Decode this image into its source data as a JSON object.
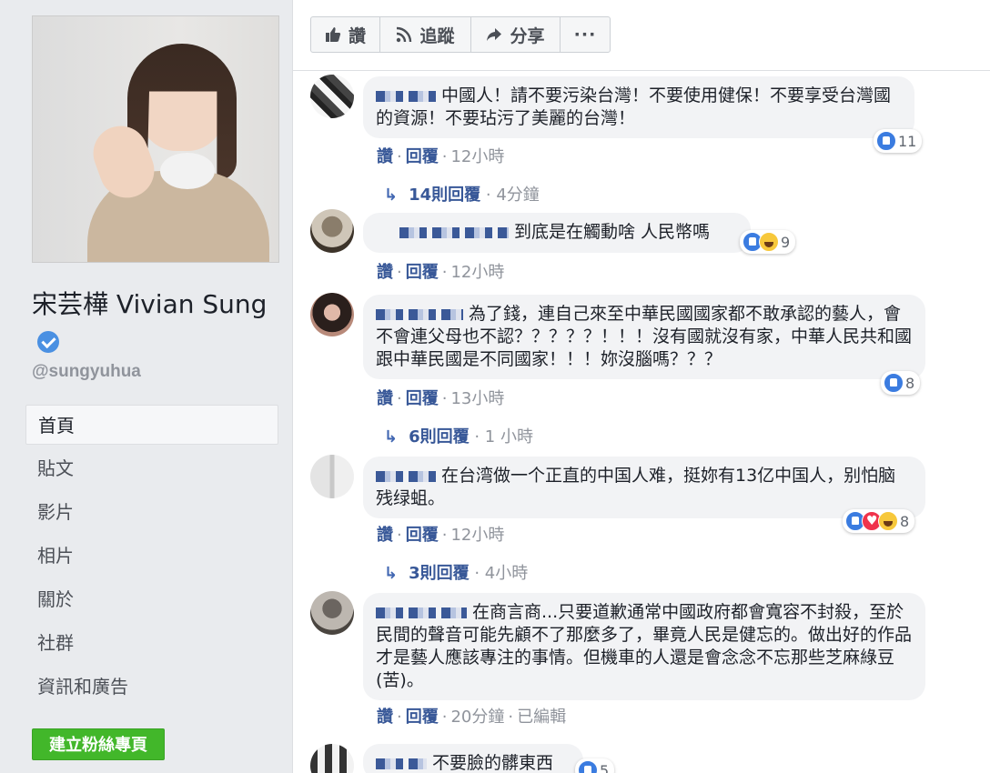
{
  "sidebar": {
    "page_name": "宋芸樺 Vivian Sung",
    "handle": "@sungyuhua",
    "nav": [
      "首頁",
      "貼文",
      "影片",
      "相片",
      "關於",
      "社群",
      "資訊和廣告"
    ],
    "create_page_label": "建立粉絲專頁"
  },
  "actions": {
    "like": "讚",
    "follow": "追蹤",
    "share": "分享",
    "more": "···"
  },
  "comments": [
    {
      "text": "中國人！請不要污染台灣！不要使用健保！不要享受台灣國的資源！不要玷污了美麗的台灣！",
      "reaction_count": "11",
      "like": "讚",
      "reply": "回覆",
      "time": "12小時",
      "replies": {
        "label": "14則回覆",
        "time": "4分鐘"
      }
    },
    {
      "text": "到底是在觸動啥 人民幣嗎",
      "reaction_count": "9",
      "like": "讚",
      "reply": "回覆",
      "time": "12小時"
    },
    {
      "text": "為了錢，連自己來至中華民國國家都不敢承認的藝人，會不會連父母也不認？？？？？！！！沒有國就沒有家，中華人民共和國跟中華民國是不同國家！！！妳沒腦嗎？？？",
      "reaction_count": "8",
      "like": "讚",
      "reply": "回覆",
      "time": "13小時",
      "replies": {
        "label": "6則回覆",
        "time": "1 小時"
      }
    },
    {
      "text": "在台湾做一个正直的中国人难，挺妳有13亿中国人，别怕脑残绿蛆。",
      "reaction_count": "8",
      "like": "讚",
      "reply": "回覆",
      "time": "12小時",
      "replies": {
        "label": "3則回覆",
        "time": "4小時"
      }
    },
    {
      "text": "在商言商...只要道歉通常中國政府都會寬容不封殺，至於民間的聲音可能先顧不了那麼多了，畢竟人民是健忘的。做出好的作品才是藝人應該專注的事情。但機車的人還是會念念不忘那些芝麻綠豆(苦)。",
      "like": "讚",
      "reply": "回覆",
      "time": "20分鐘",
      "edited": "已編輯"
    },
    {
      "text": "不要臉的髒東西",
      "reaction_count": "5"
    }
  ],
  "colors": {
    "link": "#385898",
    "accent_green": "#42b72a",
    "bubble_bg": "#f2f3f5",
    "verified": "#4a90e2"
  }
}
